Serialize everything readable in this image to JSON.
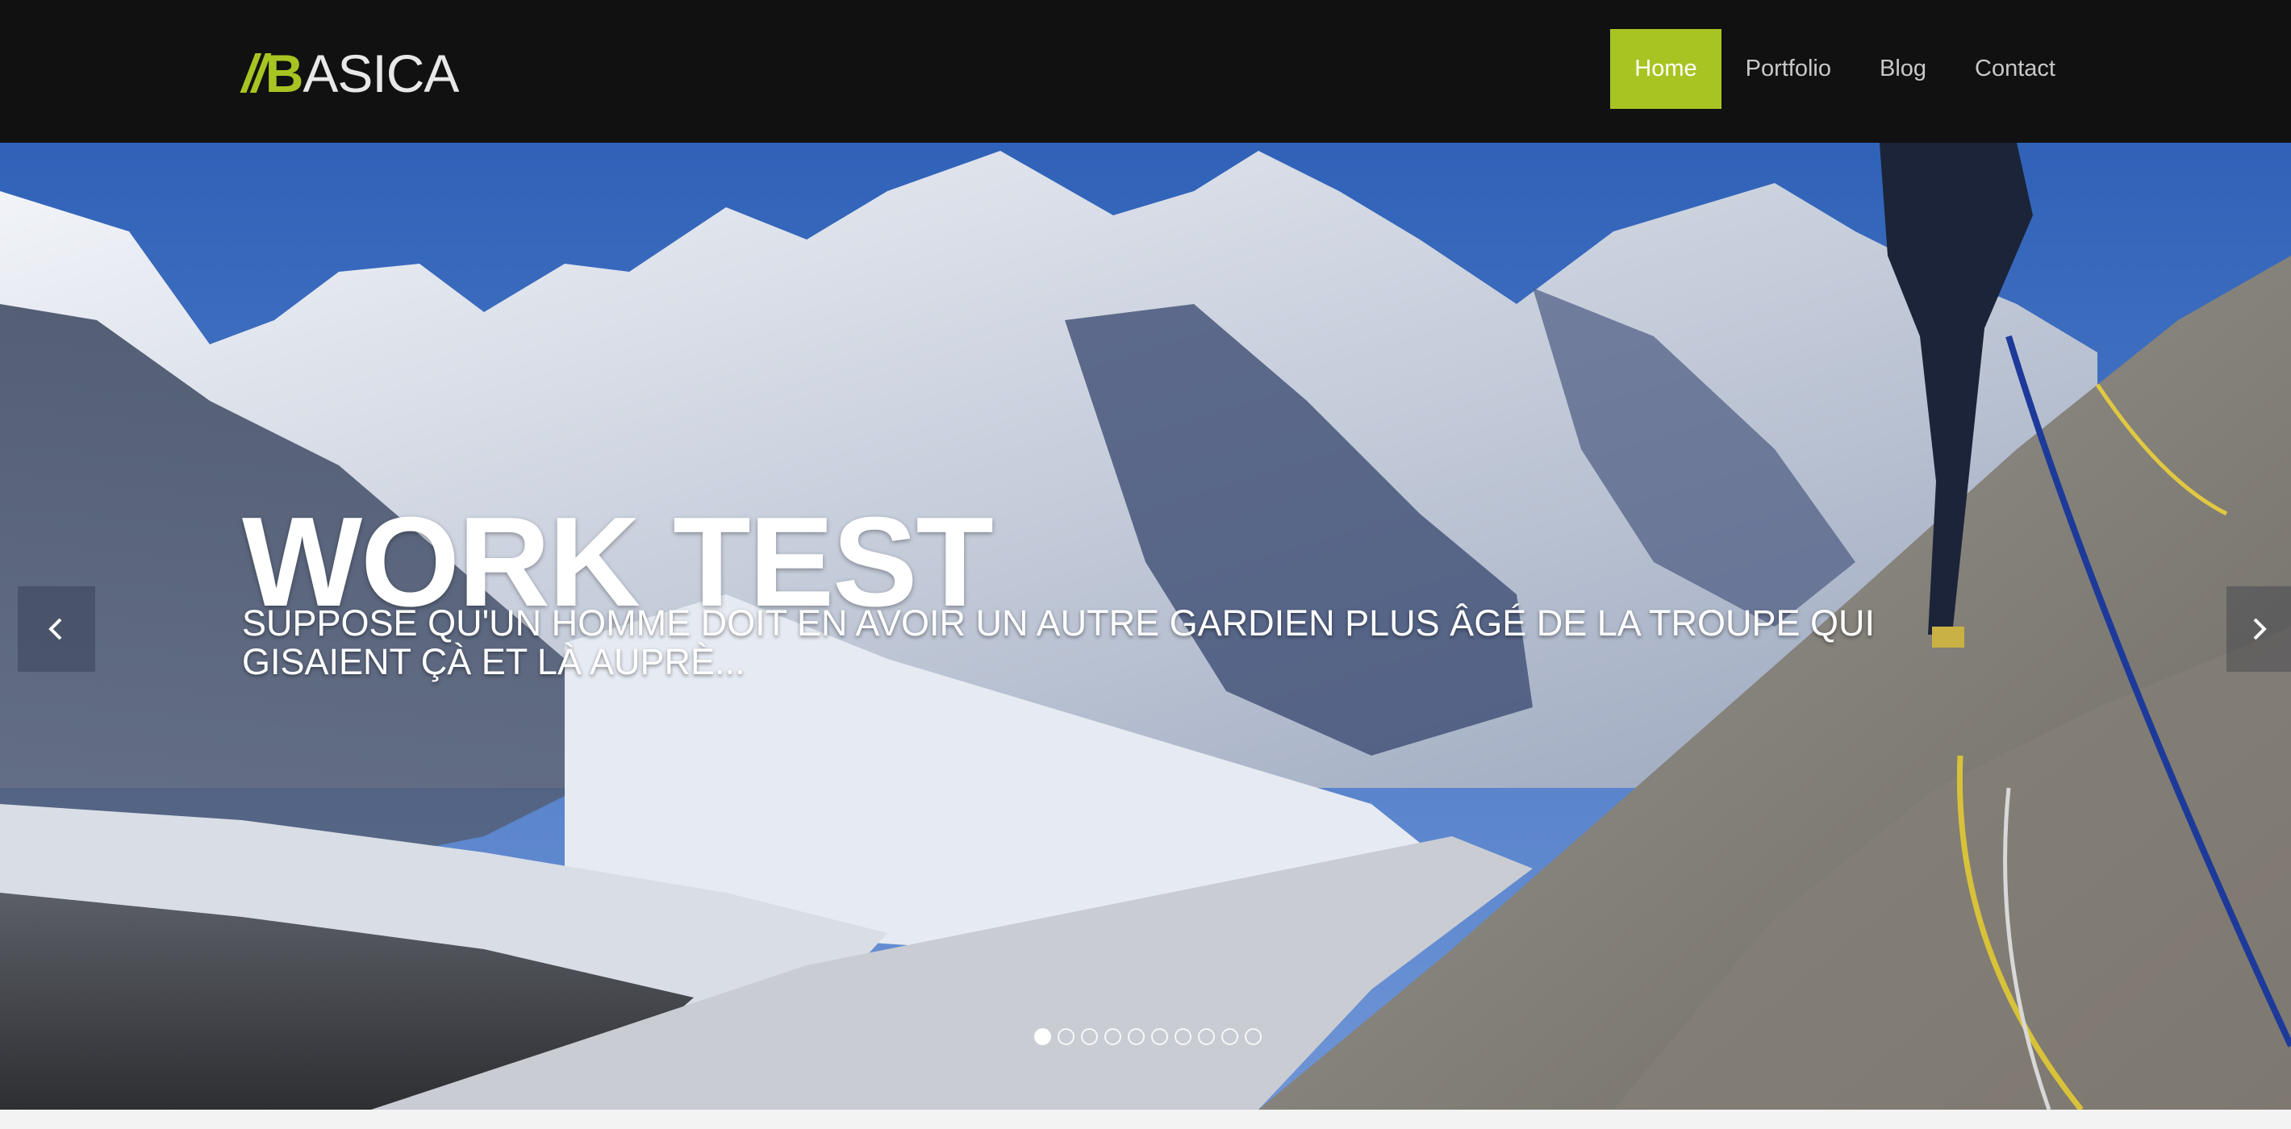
{
  "logo": {
    "slashes": "//",
    "first_letter": "B",
    "rest": "ASICA"
  },
  "nav": {
    "items": [
      {
        "label": "Home",
        "active": true
      },
      {
        "label": "Portfolio",
        "active": false
      },
      {
        "label": "Blog",
        "active": false
      },
      {
        "label": "Contact",
        "active": false
      }
    ]
  },
  "hero": {
    "title": "WORK TEST",
    "caption": "SUPPOSE QU'UN HOMME DOIT EN AVOIR UN AUTRE GARDIEN PLUS ÂGÉ DE LA TROUPE QUI GISAIENT ÇÀ ET LÀ AUPRÈ...",
    "prev_icon": "chevron-left-icon",
    "next_icon": "chevron-right-icon",
    "slide_count": 10,
    "active_slide": 1
  },
  "colors": {
    "accent": "#a8c423",
    "header_bg": "#111111",
    "nav_text": "#c8c8c8"
  }
}
